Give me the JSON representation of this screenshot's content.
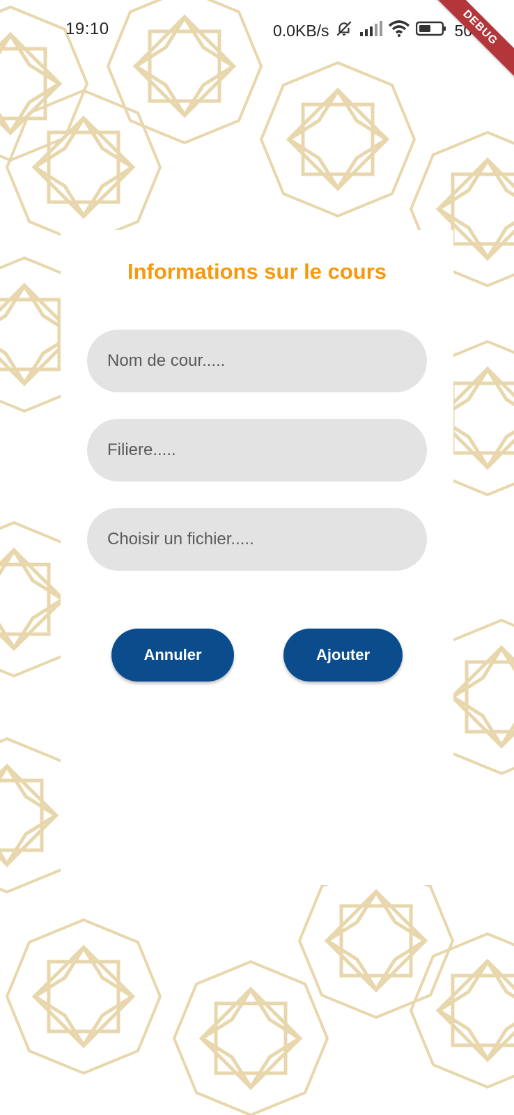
{
  "status_bar": {
    "time": "19:10",
    "speed": "0.0KB/s",
    "battery_text": "50",
    "icons": [
      "bell-off-icon",
      "signal-icon",
      "wifi-icon",
      "battery-icon"
    ]
  },
  "debug_banner": "DEBUG",
  "form": {
    "title": "Informations sur le cours",
    "name_placeholder": "Nom de cour.....",
    "filiere_placeholder": "Filiere.....",
    "file_placeholder": "Choisir un fichier....."
  },
  "buttons": {
    "cancel_label": "Annuler",
    "add_label": "Ajouter"
  },
  "colors": {
    "title": "#f7990f",
    "button": "#0b4d8c",
    "field": "#e3e3e3",
    "pattern": "#e6d3a4",
    "debug": "#b3363b"
  }
}
